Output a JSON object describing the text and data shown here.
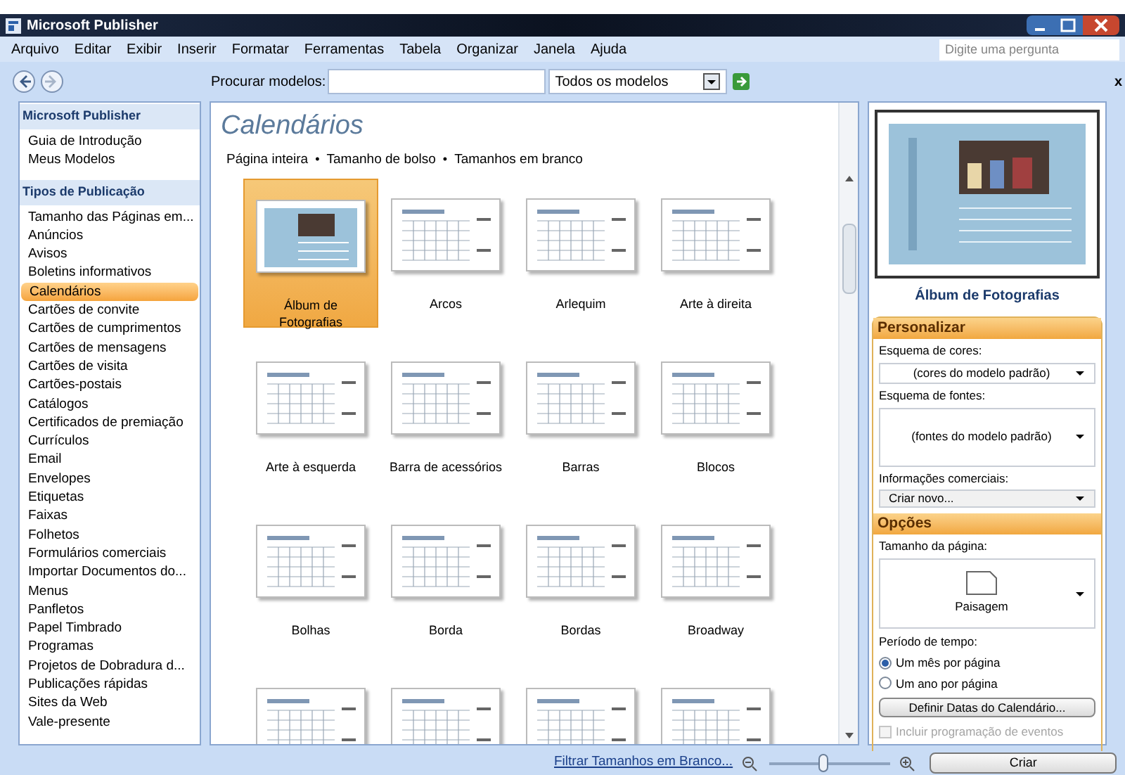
{
  "window": {
    "title": "Microsoft Publisher"
  },
  "menu": [
    "Arquivo",
    "Editar",
    "Exibir",
    "Inserir",
    "Formatar",
    "Ferramentas",
    "Tabela",
    "Organizar",
    "Janela",
    "Ajuda"
  ],
  "help_search": {
    "placeholder": "Digite uma pergunta"
  },
  "toolbar": {
    "search_label": "Procurar modelos:",
    "scope": "Todos os modelos",
    "close": "x"
  },
  "sidebar": {
    "sections": [
      {
        "title": "Microsoft Publisher",
        "items": [
          {
            "label": "Guia de Introdução",
            "selected": false
          },
          {
            "label": "Meus Modelos",
            "selected": false
          }
        ]
      },
      {
        "title": "Tipos de Publicação",
        "items": [
          {
            "label": "Tamanho das Páginas em...",
            "selected": false
          },
          {
            "label": "Anúncios",
            "selected": false
          },
          {
            "label": "Avisos",
            "selected": false
          },
          {
            "label": "Boletins informativos",
            "selected": false
          },
          {
            "label": "Calendários",
            "selected": true
          },
          {
            "label": "Cartões de convite",
            "selected": false
          },
          {
            "label": "Cartões de cumprimentos",
            "selected": false
          },
          {
            "label": "Cartões de mensagens",
            "selected": false
          },
          {
            "label": "Cartões de visita",
            "selected": false
          },
          {
            "label": "Cartões-postais",
            "selected": false
          },
          {
            "label": "Catálogos",
            "selected": false
          },
          {
            "label": "Certificados de premiação",
            "selected": false
          },
          {
            "label": "Currículos",
            "selected": false
          },
          {
            "label": "Email",
            "selected": false
          },
          {
            "label": "Envelopes",
            "selected": false
          },
          {
            "label": "Etiquetas",
            "selected": false
          },
          {
            "label": "Faixas",
            "selected": false
          },
          {
            "label": "Folhetos",
            "selected": false
          },
          {
            "label": "Formulários comerciais",
            "selected": false
          },
          {
            "label": "Importar Documentos do...",
            "selected": false
          },
          {
            "label": "Menus",
            "selected": false
          },
          {
            "label": "Panfletos",
            "selected": false
          },
          {
            "label": "Papel Timbrado",
            "selected": false
          },
          {
            "label": "Programas",
            "selected": false
          },
          {
            "label": "Projetos de Dobradura d...",
            "selected": false
          },
          {
            "label": "Publicações rápidas",
            "selected": false
          },
          {
            "label": "Sites da Web",
            "selected": false
          },
          {
            "label": "Vale-presente",
            "selected": false
          }
        ]
      }
    ]
  },
  "gallery": {
    "title": "Calendários",
    "filters": [
      "Página inteira",
      "Tamanho de bolso",
      "Tamanhos em branco"
    ],
    "filter_separator": "•",
    "templates": [
      {
        "label": "Álbum de Fotografias",
        "selected": true
      },
      {
        "label": "Arcos",
        "selected": false
      },
      {
        "label": "Arlequim",
        "selected": false
      },
      {
        "label": "Arte à direita",
        "selected": false
      },
      {
        "label": "Arte à esquerda",
        "selected": false
      },
      {
        "label": "Barra de acessórios",
        "selected": false
      },
      {
        "label": "Barras",
        "selected": false
      },
      {
        "label": "Blocos",
        "selected": false
      },
      {
        "label": "Bolhas",
        "selected": false
      },
      {
        "label": "Borda",
        "selected": false
      },
      {
        "label": "Bordas",
        "selected": false
      },
      {
        "label": "Broadway",
        "selected": false
      },
      {
        "selected": false
      },
      {
        "selected": false
      },
      {
        "selected": false
      },
      {
        "selected": false
      }
    ]
  },
  "preview": {
    "caption": "Álbum de Fotografias"
  },
  "customize": {
    "title": "Personalizar",
    "fields": [
      {
        "label": "Esquema de cores:",
        "value": "(cores do modelo padrão)",
        "kind": "dropdown"
      },
      {
        "label": "Esquema de fontes:",
        "value": "(fontes do modelo padrão)",
        "kind": "tall"
      },
      {
        "label": "Informações comerciais:",
        "value": "Criar novo...",
        "kind": "combo"
      }
    ]
  },
  "options": {
    "title": "Opções",
    "page_size_label": "Tamanho da página:",
    "page_size": "Paisagem",
    "period_label": "Período de tempo:",
    "periods": [
      {
        "label": "Um mês por página",
        "selected": true
      },
      {
        "label": "Um ano por página",
        "selected": false
      }
    ],
    "dates_button": "Definir Datas do Calendário...",
    "events": {
      "label": "Incluir programação de eventos",
      "checked": false,
      "disabled": true
    }
  },
  "status_bar": {
    "filter_link": "Filtrar Tamanhos em Branco...",
    "zoom": {
      "level": 0.45
    },
    "create_button": "Criar"
  }
}
